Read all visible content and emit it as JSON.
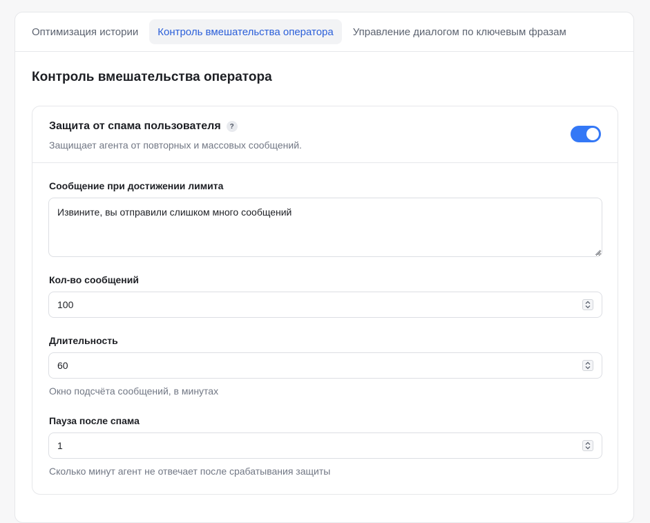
{
  "tabs": [
    {
      "label": "Оптимизация истории",
      "active": false
    },
    {
      "label": "Контроль вмешательства оператора",
      "active": true
    },
    {
      "label": "Управление диалогом по ключевым фразам",
      "active": false
    }
  ],
  "section": {
    "title": "Контроль вмешательства оператора"
  },
  "spam": {
    "title": "Защита от спама пользователя",
    "help_icon": "?",
    "description": "Защищает агента от повторных и массовых сообщений.",
    "enabled": true,
    "limit_message": {
      "label": "Сообщение при достижении лимита",
      "value": "Извините, вы отправили слишком много сообщений"
    },
    "message_count": {
      "label": "Кол-во сообщений",
      "value": "100"
    },
    "duration": {
      "label": "Длительность",
      "value": "60",
      "hint": "Окно подсчёта сообщений, в минутах"
    },
    "pause": {
      "label": "Пауза после спама",
      "value": "1",
      "hint": "Сколько минут агент не отвечает после срабатывания защиты"
    }
  },
  "colors": {
    "accent": "#3478f6",
    "active_tab_text": "#2b5fd9"
  }
}
